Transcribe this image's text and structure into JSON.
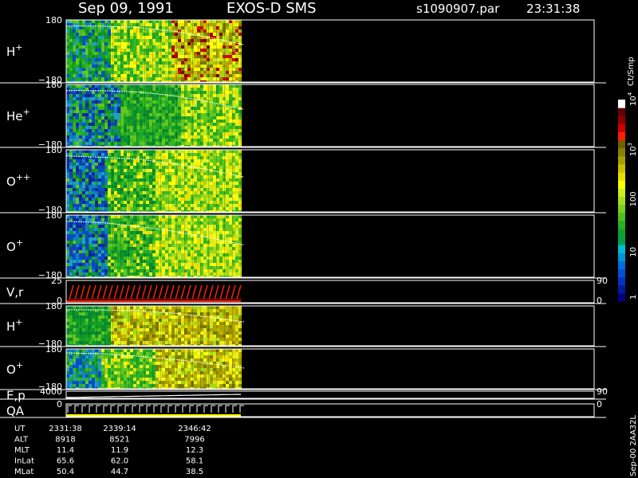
{
  "header": {
    "date": "Sep 09, 1991",
    "instrument": "EXOS-D SMS",
    "file": "s1090907.par",
    "time": "23:31:38"
  },
  "chart_data": {
    "type": "heatmap",
    "panels": [
      {
        "id": "h1",
        "label": "H",
        "sup": "+",
        "ytop": "180",
        "ybot": "−180",
        "ylim": [
          -180,
          180
        ],
        "palette": "h",
        "curve": [
          0.1,
          0.1,
          0.12,
          0.18,
          0.28,
          0.4
        ]
      },
      {
        "id": "he",
        "label": "He",
        "sup": "+",
        "ytop": "180",
        "ybot": "−180",
        "ylim": [
          -180,
          180
        ],
        "palette": "he",
        "curve": [
          0.1,
          0.1,
          0.12,
          0.18,
          0.28,
          0.4
        ]
      },
      {
        "id": "opp",
        "label": "O",
        "sup": "++",
        "ytop": "180",
        "ybot": "−180",
        "ylim": [
          -180,
          180
        ],
        "palette": "o",
        "curve": [
          0.1,
          0.12,
          0.15,
          0.22,
          0.32,
          0.44
        ]
      },
      {
        "id": "op",
        "label": "O",
        "sup": "+",
        "ytop": "180",
        "ybot": "−180",
        "ylim": [
          -180,
          180
        ],
        "palette": "o",
        "curve": [
          0.1,
          0.12,
          0.18,
          0.26,
          0.36,
          0.48
        ]
      },
      {
        "id": "vr",
        "label": "V,r",
        "sup": "",
        "ytop": "25",
        "ybot": "0",
        "ylim": [
          0,
          25
        ],
        "right_top": "90",
        "right_bot": "0"
      },
      {
        "id": "h2",
        "label": "H",
        "sup": "+",
        "ytop": "180",
        "ybot": "−180",
        "ylim": [
          -180,
          180
        ],
        "palette": "h2",
        "curve": [
          0.1,
          0.1,
          0.12,
          0.18,
          0.28,
          0.4
        ]
      },
      {
        "id": "o2",
        "label": "O",
        "sup": "+",
        "ytop": "180",
        "ybot": "−180",
        "ylim": [
          -180,
          180
        ],
        "palette": "o2",
        "curve": [
          0.1,
          0.12,
          0.18,
          0.26,
          0.36,
          0.48
        ]
      },
      {
        "id": "ep",
        "label": "E,p",
        "sup": "",
        "ytop": "4000",
        "ybot": "",
        "right_top": "90",
        "right_bot": ""
      },
      {
        "id": "qa",
        "label": "QA",
        "sup": "",
        "ytop": "0",
        "ybot": "",
        "right_top": "0",
        "right_bot": ""
      }
    ],
    "colorbar": {
      "unit": "Ct/Smp",
      "ticks": [
        {
          "label": "1",
          "frac": 0.0
        },
        {
          "label": "10",
          "frac": 0.25
        },
        {
          "label": "100",
          "frac": 0.5
        },
        {
          "label": "10",
          "sup": "3",
          "frac": 0.75
        },
        {
          "label": "10",
          "sup": "4",
          "frac": 1.0
        }
      ],
      "colors": [
        "#000080",
        "#001a9c",
        "#0033c0",
        "#0050d8",
        "#006ee0",
        "#0096d8",
        "#00bcd4",
        "#00a050",
        "#10a030",
        "#28b020",
        "#50c020",
        "#78d020",
        "#a0e020",
        "#c8f020",
        "#ffff00",
        "#e8e000",
        "#c8c000",
        "#a8a000",
        "#888000",
        "#706000",
        "#ff2000",
        "#d00000",
        "#900000",
        "#600000",
        "#ffffff"
      ]
    },
    "orbit_rows": [
      {
        "name": "UT",
        "values": [
          "2331:38",
          "2339:14",
          "2346:42"
        ]
      },
      {
        "name": "ALT",
        "values": [
          "8918",
          "8521",
          "7996"
        ]
      },
      {
        "name": "MLT",
        "values": [
          "11.4",
          "11.9",
          "12.3"
        ]
      },
      {
        "name": "InLat",
        "values": [
          "65.6",
          "62.0",
          "58.1"
        ]
      },
      {
        "name": "MLat",
        "values": [
          "50.4",
          "44.7",
          "38.5"
        ]
      }
    ],
    "side_label": "Sep-00 2AA32L"
  }
}
